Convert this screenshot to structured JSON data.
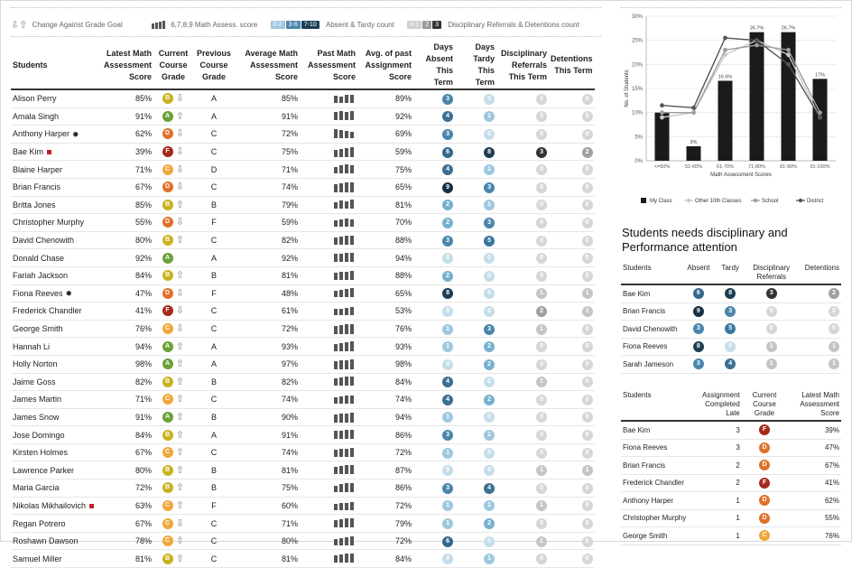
{
  "legend": {
    "goal_label": "Change Against Grade Goal",
    "math_label": "6,7,8,9 Math Assess. score",
    "absent_chips": [
      "0-2",
      "3-6",
      "7-10"
    ],
    "absent_label": "Absent & Tardy count",
    "ref_chips": [
      "0-1",
      "2",
      "3"
    ],
    "ref_label": "Disciplinary Referrals & Detentions count"
  },
  "main_table": {
    "headers": [
      "Students",
      "Latest Math Assessment Score",
      "Current Course Grade",
      "Previous Course Grade",
      "Average Math Assessment Score",
      "Past Math Assessment Score",
      "Avg. of past Assignment Score",
      "Days Absent This Term",
      "Days Tardy This Term",
      "Disciplinary Referrals This Term",
      "Detentions This Term"
    ],
    "rows": [
      {
        "name": "Alison Perry",
        "flag": "",
        "latest": "85%",
        "grade": "B",
        "trend": "down",
        "prev": "A",
        "avg": "85%",
        "spark": [
          6,
          5,
          7,
          7
        ],
        "assign": "89%",
        "absent": "3",
        "tardy": "0",
        "ref": "0",
        "det": "0"
      },
      {
        "name": "Amala Singh",
        "flag": "",
        "latest": "91%",
        "grade": "A",
        "trend": "up",
        "prev": "A",
        "avg": "91%",
        "spark": [
          7,
          8,
          7,
          8
        ],
        "assign": "92%",
        "absent": "4",
        "tardy": "1",
        "ref": "0",
        "det": "0"
      },
      {
        "name": "Anthony Harper",
        "flag": "star",
        "latest": "62%",
        "grade": "D",
        "trend": "down",
        "prev": "C",
        "avg": "72%",
        "spark": [
          8,
          7,
          6,
          5
        ],
        "assign": "69%",
        "absent": "3",
        "tardy": "0",
        "ref": "0",
        "det": "0"
      },
      {
        "name": "Bae Kim",
        "flag": "red",
        "latest": "39%",
        "grade": "F",
        "trend": "down",
        "prev": "C",
        "avg": "75%",
        "spark": [
          6,
          7,
          8,
          9
        ],
        "assign": "59%",
        "absent": "6",
        "tardy": "8",
        "ref": "3",
        "det": "2"
      },
      {
        "name": "Blaine Harper",
        "flag": "",
        "latest": "71%",
        "grade": "C",
        "trend": "down",
        "prev": "D",
        "avg": "71%",
        "spark": [
          5,
          7,
          8,
          7
        ],
        "assign": "75%",
        "absent": "4",
        "tardy": "1",
        "ref": "0",
        "det": "0"
      },
      {
        "name": "Brian Francis",
        "flag": "",
        "latest": "67%",
        "grade": "D",
        "trend": "down",
        "prev": "C",
        "avg": "74%",
        "spark": [
          7,
          8,
          9,
          9
        ],
        "assign": "65%",
        "absent": "9",
        "tardy": "3",
        "ref": "0",
        "det": "0"
      },
      {
        "name": "Britta Jones",
        "flag": "",
        "latest": "85%",
        "grade": "B",
        "trend": "up",
        "prev": "B",
        "avg": "79%",
        "spark": [
          5,
          7,
          6,
          8
        ],
        "assign": "81%",
        "absent": "2",
        "tardy": "1",
        "ref": "0",
        "det": "0"
      },
      {
        "name": "Christopher Murphy",
        "flag": "",
        "latest": "55%",
        "grade": "D",
        "trend": "down",
        "prev": "F",
        "avg": "59%",
        "spark": [
          5,
          6,
          7,
          6
        ],
        "assign": "70%",
        "absent": "2",
        "tardy": "3",
        "ref": "0",
        "det": "0"
      },
      {
        "name": "David Chenowith",
        "flag": "",
        "latest": "80%",
        "grade": "B",
        "trend": "up",
        "prev": "C",
        "avg": "82%",
        "spark": [
          6,
          7,
          8,
          8
        ],
        "assign": "88%",
        "absent": "3",
        "tardy": "5",
        "ref": "0",
        "det": "0"
      },
      {
        "name": "Donald Chase",
        "flag": "",
        "latest": "92%",
        "grade": "A",
        "trend": "",
        "prev": "A",
        "avg": "92%",
        "spark": [
          7,
          7,
          8,
          8
        ],
        "assign": "94%",
        "absent": "0",
        "tardy": "0",
        "ref": "0",
        "det": "0"
      },
      {
        "name": "Fariah Jackson",
        "flag": "",
        "latest": "84%",
        "grade": "B",
        "trend": "up",
        "prev": "B",
        "avg": "81%",
        "spark": [
          6,
          7,
          7,
          8
        ],
        "assign": "88%",
        "absent": "2",
        "tardy": "0",
        "ref": "0",
        "det": "0"
      },
      {
        "name": "Fiona Reeves",
        "flag": "star",
        "latest": "47%",
        "grade": "D",
        "trend": "down",
        "prev": "F",
        "avg": "48%",
        "spark": [
          5,
          6,
          7,
          8
        ],
        "assign": "65%",
        "absent": "8",
        "tardy": "0",
        "ref": "1",
        "det": "1"
      },
      {
        "name": "Frederick Chandler",
        "flag": "",
        "latest": "41%",
        "grade": "F",
        "trend": "down",
        "prev": "C",
        "avg": "61%",
        "spark": [
          5,
          5,
          6,
          7
        ],
        "assign": "53%",
        "absent": "0",
        "tardy": "0",
        "ref": "2",
        "det": "1"
      },
      {
        "name": "George Smith",
        "flag": "",
        "latest": "76%",
        "grade": "C",
        "trend": "down",
        "prev": "C",
        "avg": "72%",
        "spark": [
          7,
          8,
          9,
          9
        ],
        "assign": "76%",
        "absent": "1",
        "tardy": "3",
        "ref": "1",
        "det": "0"
      },
      {
        "name": "Hannah Li",
        "flag": "",
        "latest": "94%",
        "grade": "A",
        "trend": "up",
        "prev": "A",
        "avg": "93%",
        "spark": [
          6,
          7,
          8,
          9
        ],
        "assign": "93%",
        "absent": "1",
        "tardy": "2",
        "ref": "0",
        "det": "0"
      },
      {
        "name": "Holly Norton",
        "flag": "",
        "latest": "98%",
        "grade": "A",
        "trend": "up",
        "prev": "A",
        "avg": "97%",
        "spark": [
          7,
          8,
          8,
          9
        ],
        "assign": "98%",
        "absent": "0",
        "tardy": "2",
        "ref": "0",
        "det": "0"
      },
      {
        "name": "Jaime Goss",
        "flag": "",
        "latest": "82%",
        "grade": "B",
        "trend": "up",
        "prev": "B",
        "avg": "82%",
        "spark": [
          6,
          7,
          8,
          8
        ],
        "assign": "84%",
        "absent": "4",
        "tardy": "0",
        "ref": "1",
        "det": "0"
      },
      {
        "name": "James Martin",
        "flag": "",
        "latest": "71%",
        "grade": "C",
        "trend": "up",
        "prev": "C",
        "avg": "74%",
        "spark": [
          5,
          6,
          7,
          7
        ],
        "assign": "74%",
        "absent": "4",
        "tardy": "2",
        "ref": "0",
        "det": "0"
      },
      {
        "name": "James Snow",
        "flag": "",
        "latest": "91%",
        "grade": "A",
        "trend": "up",
        "prev": "B",
        "avg": "90%",
        "spark": [
          7,
          8,
          8,
          9
        ],
        "assign": "94%",
        "absent": "1",
        "tardy": "0",
        "ref": "0",
        "det": "0"
      },
      {
        "name": "Jose Domingo",
        "flag": "",
        "latest": "84%",
        "grade": "B",
        "trend": "up",
        "prev": "A",
        "avg": "91%",
        "spark": [
          7,
          7,
          8,
          8
        ],
        "assign": "86%",
        "absent": "3",
        "tardy": "1",
        "ref": "0",
        "det": "0"
      },
      {
        "name": "Kirsten Holmes",
        "flag": "",
        "latest": "67%",
        "grade": "C",
        "trend": "up",
        "prev": "C",
        "avg": "74%",
        "spark": [
          6,
          7,
          7,
          8
        ],
        "assign": "72%",
        "absent": "1",
        "tardy": "0",
        "ref": "0",
        "det": "0"
      },
      {
        "name": "Lawrence Parker",
        "flag": "",
        "latest": "80%",
        "grade": "B",
        "trend": "up",
        "prev": "B",
        "avg": "81%",
        "spark": [
          6,
          7,
          8,
          8
        ],
        "assign": "87%",
        "absent": "0",
        "tardy": "0",
        "ref": "1",
        "det": "1"
      },
      {
        "name": "Maria Garcia",
        "flag": "",
        "latest": "72%",
        "grade": "B",
        "trend": "up",
        "prev": "B",
        "avg": "75%",
        "spark": [
          5,
          7,
          8,
          8
        ],
        "assign": "86%",
        "absent": "3",
        "tardy": "4",
        "ref": "0",
        "det": "0"
      },
      {
        "name": "Nikolas Mikhailovich",
        "flag": "red",
        "latest": "63%",
        "grade": "C",
        "trend": "up",
        "prev": "F",
        "avg": "60%",
        "spark": [
          5,
          6,
          6,
          7
        ],
        "assign": "72%",
        "absent": "1",
        "tardy": "1",
        "ref": "1",
        "det": "0"
      },
      {
        "name": "Regan Potrero",
        "flag": "",
        "latest": "67%",
        "grade": "C",
        "trend": "down",
        "prev": "C",
        "avg": "71%",
        "spark": [
          6,
          7,
          8,
          8
        ],
        "assign": "79%",
        "absent": "1",
        "tardy": "2",
        "ref": "0",
        "det": "0"
      },
      {
        "name": "Roshawn Dawson",
        "flag": "",
        "latest": "78%",
        "grade": "C",
        "trend": "up",
        "prev": "C",
        "avg": "80%",
        "spark": [
          5,
          6,
          7,
          8
        ],
        "assign": "72%",
        "absent": "6",
        "tardy": "0",
        "ref": "1",
        "det": "0"
      },
      {
        "name": "Samuel Miller",
        "flag": "",
        "latest": "81%",
        "grade": "B",
        "trend": "up",
        "prev": "C",
        "avg": "81%",
        "spark": [
          6,
          7,
          8,
          8
        ],
        "assign": "84%",
        "absent": "0",
        "tardy": "1",
        "ref": "0",
        "det": "0"
      }
    ]
  },
  "chart_data": {
    "type": "bar",
    "categories": [
      "<=50%",
      "51-60%",
      "61-70%",
      "71-80%",
      "81-90%",
      "91-100%"
    ],
    "title": "",
    "xlabel": "Math Assessment Scores",
    "ylabel": "No. of Students",
    "ylim": [
      0,
      30
    ],
    "yticks": [
      "0%",
      "5%",
      "10%",
      "15%",
      "20%",
      "25%",
      "30%"
    ],
    "bar_labels": [
      "",
      "3%",
      "16.6%",
      "26.7%",
      "26.7%",
      "17%"
    ],
    "series": [
      {
        "name": "My Class",
        "kind": "bar",
        "values": [
          10,
          3,
          16.6,
          26.7,
          26.7,
          17
        ]
      },
      {
        "name": "Other 10th Classes",
        "kind": "line",
        "values": [
          9,
          10,
          22,
          25,
          22,
          9
        ]
      },
      {
        "name": "School",
        "kind": "line",
        "values": [
          10,
          10,
          23,
          24,
          23,
          10
        ]
      },
      {
        "name": "District",
        "kind": "line",
        "values": [
          11.5,
          11,
          25.5,
          25,
          20,
          9
        ]
      }
    ],
    "grid": true,
    "legend_position": "bottom"
  },
  "attention": {
    "title": "Students needs disciplinary and Performance attention",
    "table1_headers": [
      "Students",
      "Absent",
      "Tardy",
      "Disciplinary Referrals",
      "Detentions"
    ],
    "table1_rows": [
      {
        "name": "Bae Kim",
        "absent": "6",
        "tardy": "8",
        "ref": "3",
        "det": "2"
      },
      {
        "name": "Brian Francis",
        "absent": "9",
        "tardy": "3",
        "ref": "0",
        "det": "0"
      },
      {
        "name": "David Chenowith",
        "absent": "3",
        "tardy": "5",
        "ref": "0",
        "det": "0"
      },
      {
        "name": "Fiona Reeves",
        "absent": "8",
        "tardy": "0",
        "ref": "1",
        "det": "1"
      },
      {
        "name": "Sarah Jameson",
        "absent": "3",
        "tardy": "4",
        "ref": "1",
        "det": "1"
      }
    ],
    "table2_headers": [
      "Students",
      "Assignment Completed Late",
      "Current Course Grade",
      "Latest Math Assessment Score"
    ],
    "table2_rows": [
      {
        "name": "Bae Kim",
        "late": "3",
        "grade": "F",
        "score": "39%"
      },
      {
        "name": "Fiona Reeves",
        "late": "3",
        "grade": "D",
        "score": "47%"
      },
      {
        "name": "Brian Francis",
        "late": "2",
        "grade": "D",
        "score": "67%"
      },
      {
        "name": "Frederick Chandler",
        "late": "2",
        "grade": "F",
        "score": "41%"
      },
      {
        "name": "Anthony Harper",
        "late": "1",
        "grade": "D",
        "score": "62%"
      },
      {
        "name": "Christopher Murphy",
        "late": "1",
        "grade": "D",
        "score": "55%"
      },
      {
        "name": "George Smith",
        "late": "1",
        "grade": "C",
        "score": "76%"
      }
    ]
  }
}
